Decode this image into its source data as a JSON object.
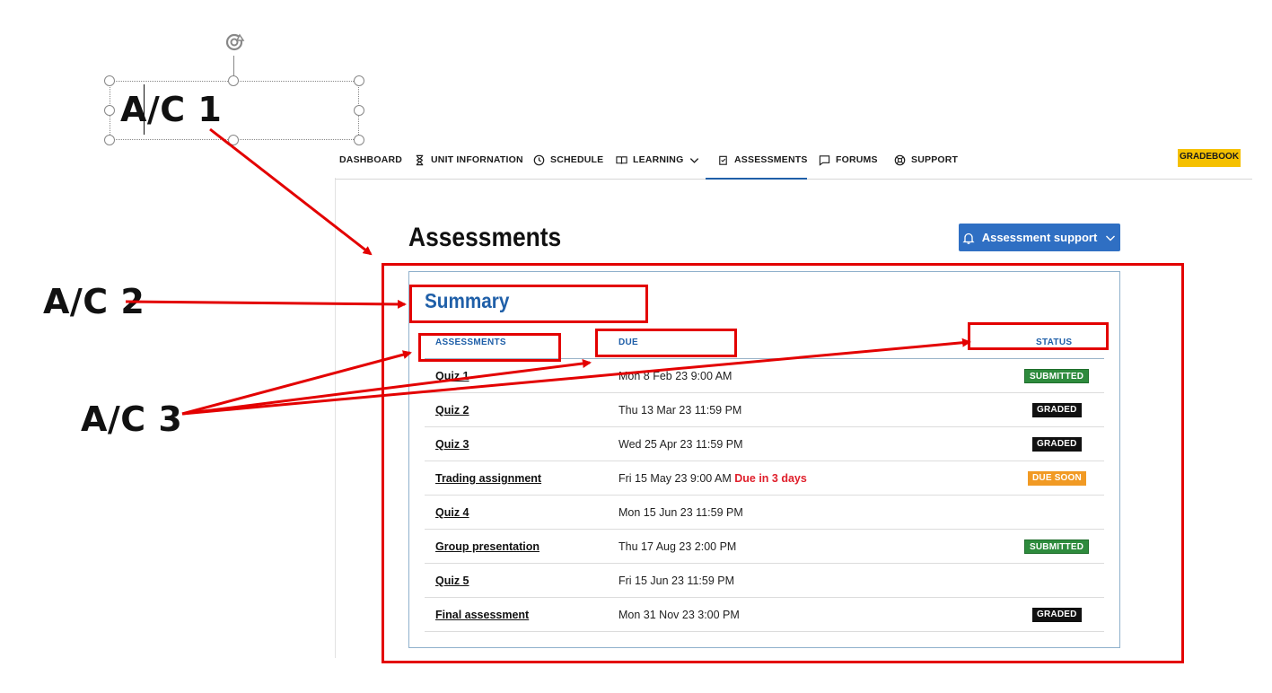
{
  "annotations": {
    "ac1": "A/C 1",
    "ac2": "A/C 2",
    "ac3": "A/C 3"
  },
  "nav": {
    "items": [
      {
        "label": "DASHBOARD",
        "icon": "none"
      },
      {
        "label": "UNIT INFORNATION",
        "icon": "hourglass-icon"
      },
      {
        "label": "SCHEDULE",
        "icon": "clock-icon"
      },
      {
        "label": "LEARNING",
        "icon": "book-icon"
      },
      {
        "label": "ASSESSMENTS",
        "icon": "assessments-icon",
        "active": true
      },
      {
        "label": "FORUMS",
        "icon": "chat-bubble-icon"
      },
      {
        "label": "SUPPORT",
        "icon": "lifebuoy-icon"
      }
    ],
    "gradebook_label": "GRADEBOOK"
  },
  "page": {
    "title": "Assessments",
    "support_button": "Assessment support"
  },
  "summary": {
    "title": "Summary",
    "columns": {
      "assessments": "ASSESSMENTS",
      "due": "DUE",
      "status": "STATUS"
    },
    "rows": [
      {
        "name": "Quiz 1",
        "due": "Mon 8 Feb 23 9:00 AM",
        "note": "",
        "status": "SUBMITTED",
        "status_kind": "submitted"
      },
      {
        "name": "Quiz 2",
        "due": "Thu 13 Mar 23 11:59 PM",
        "note": "",
        "status": "GRADED",
        "status_kind": "graded"
      },
      {
        "name": "Quiz 3",
        "due": "Wed 25 Apr 23 11:59 PM",
        "note": "",
        "status": "GRADED",
        "status_kind": "graded"
      },
      {
        "name": "Trading assignment",
        "due": "Fri 15 May 23 9:00 AM",
        "note": "Due in 3 days",
        "status": "DUE SOON",
        "status_kind": "duesoon"
      },
      {
        "name": "Quiz 4",
        "due": "Mon 15 Jun 23 11:59 PM",
        "note": "",
        "status": "",
        "status_kind": ""
      },
      {
        "name": "Group presentation",
        "due": "Thu 17 Aug 23 2:00 PM",
        "note": "",
        "status": "SUBMITTED",
        "status_kind": "submitted"
      },
      {
        "name": "Quiz 5",
        "due": "Fri 15 Jun 23 11:59 PM",
        "note": "",
        "status": "",
        "status_kind": ""
      },
      {
        "name": "Final assessment",
        "due": "Mon 31 Nov 23 3:00 PM",
        "note": "",
        "status": "GRADED",
        "status_kind": "graded"
      }
    ]
  },
  "colors": {
    "annotation_red": "#e30000",
    "primary_blue": "#1f5fa8",
    "button_blue": "#2f6fc3",
    "gradebook_yellow": "#f5c000",
    "submitted_green": "#2e8b3d",
    "graded_black": "#111111",
    "due_soon_orange": "#f19a24",
    "due_note_red": "#e0202c"
  }
}
